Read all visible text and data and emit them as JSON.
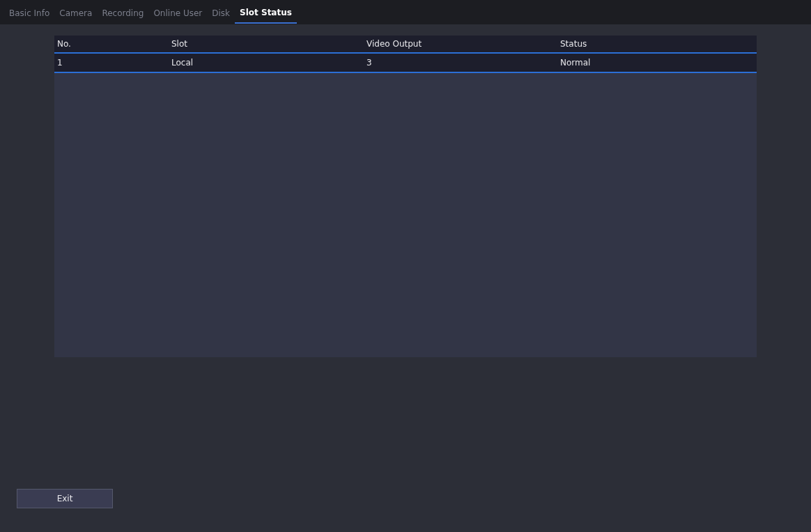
{
  "tabs": [
    {
      "label": "Basic Info",
      "selected": false
    },
    {
      "label": "Camera",
      "selected": false
    },
    {
      "label": "Recording",
      "selected": false
    },
    {
      "label": "Online User",
      "selected": false
    },
    {
      "label": "Disk",
      "selected": false
    },
    {
      "label": "Slot Status",
      "selected": true
    }
  ],
  "table": {
    "columns": [
      "No.",
      "Slot",
      "Video Output",
      "Status"
    ],
    "rows": [
      [
        "1",
        "Local",
        "3",
        "Normal"
      ]
    ]
  },
  "buttons": [
    "Exit"
  ]
}
